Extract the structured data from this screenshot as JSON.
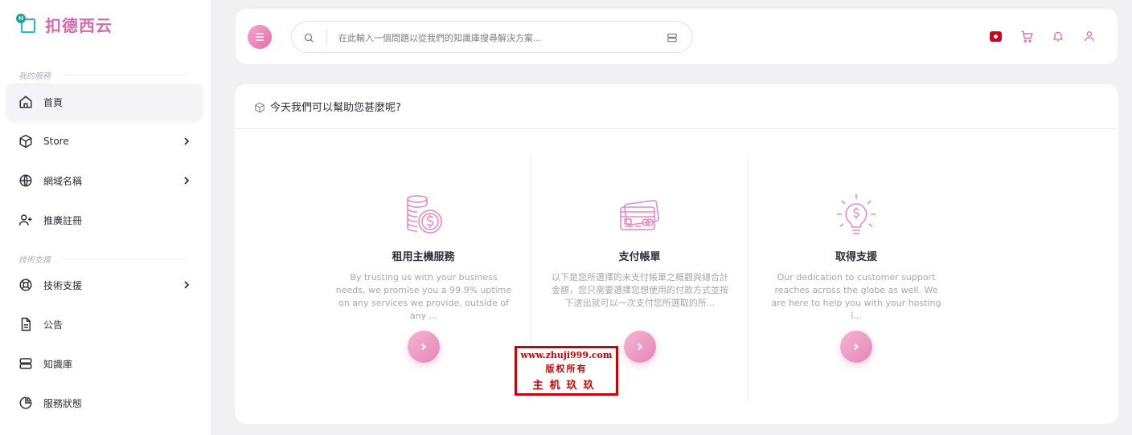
{
  "brand": {
    "name": "扣德西云",
    "mark_letter": "H"
  },
  "sidebar": {
    "section1": "我的服務",
    "section2": "技術支援",
    "items": [
      {
        "label": "首頁",
        "icon": "home-icon",
        "has_submenu": false,
        "active": true
      },
      {
        "label": "Store",
        "icon": "box-icon",
        "has_submenu": true
      },
      {
        "label": "網域名稱",
        "icon": "globe-icon",
        "has_submenu": true
      },
      {
        "label": "推廣註冊",
        "icon": "user-plus-icon",
        "has_submenu": false
      },
      {
        "label": "技術支援",
        "icon": "lifebuoy-icon",
        "has_submenu": true
      },
      {
        "label": "公告",
        "icon": "document-icon",
        "has_submenu": false
      },
      {
        "label": "知識庫",
        "icon": "server-icon",
        "has_submenu": false
      },
      {
        "label": "服務狀態",
        "icon": "pie-chart-icon",
        "has_submenu": false
      }
    ]
  },
  "header": {
    "search_placeholder": "在此輸入一個問題以從我們的知識庫搜尋解決方案...",
    "icons": [
      "flag-icon",
      "cart-icon",
      "bell-icon",
      "user-icon"
    ]
  },
  "main": {
    "title": "今天我們可以幫助您甚麼呢?",
    "cards": [
      {
        "title": "租用主機服務",
        "desc": "By trusting us with your business needs, we promise you a 99.9% uptime on any services we provide, outside of any ...",
        "icon": "coins-icon"
      },
      {
        "title": "支付帳單",
        "desc": "以下是您所選擇的未支付帳單之概觀與總合計金額，您只需要選擇您想使用的付款方式並按下送出就可以一次支付您所選取的所...",
        "icon": "credit-card-icon"
      },
      {
        "title": "取得支援",
        "desc": "Our dedication to customer support reaches across the globe as well. We are here to help you with your hosting i...",
        "icon": "lightbulb-icon"
      }
    ]
  },
  "watermark": {
    "line1": "www.zhuji999.com",
    "line2": "版权所有",
    "line3": "主机玖玖"
  },
  "colors": {
    "accent": "#e36fa7",
    "accent_light": "#f5a8cc",
    "brand": "#d86aa8",
    "watermark": "#d00000"
  }
}
